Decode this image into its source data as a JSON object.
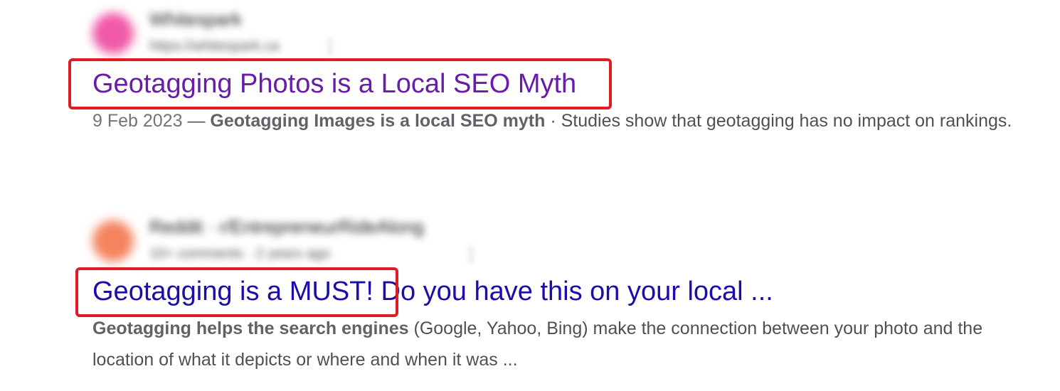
{
  "results": [
    {
      "source": {
        "name": "Whitespark",
        "url": "https://whitespark.ca",
        "menu_glyph": "⋮",
        "favicon_color": "#f05aa8"
      },
      "title": "Geotagging Photos is a Local SEO Myth",
      "title_color": "#681da8",
      "snippet": {
        "date": "9 Feb 2023",
        "separator": " — ",
        "bold": "Geotagging Images is a local SEO myth",
        "dot": " · ",
        "rest": "Studies show that geotagging has no impact on rankings."
      }
    },
    {
      "source": {
        "name": "Reddit · r/EntrepreneurRideAlong",
        "url": "10+ comments · 2 years ago",
        "menu_glyph": "⋮",
        "favicon_color": "#f4845f"
      },
      "title_highlighted": "Geotagging is a MUST!",
      "title_rest": " Do you have this on your local ...",
      "title_color": "#1a0dab",
      "snippet": {
        "bold": "Geotagging helps the search engines",
        "rest": " (Google, Yahoo, Bing) make the connection between your photo and the location of what it depicts or where and when it was ..."
      }
    }
  ],
  "colors": {
    "highlight": "#e01b24",
    "visited_link": "#681da8",
    "link": "#1a0dab",
    "snippet_text": "#4d5156"
  }
}
